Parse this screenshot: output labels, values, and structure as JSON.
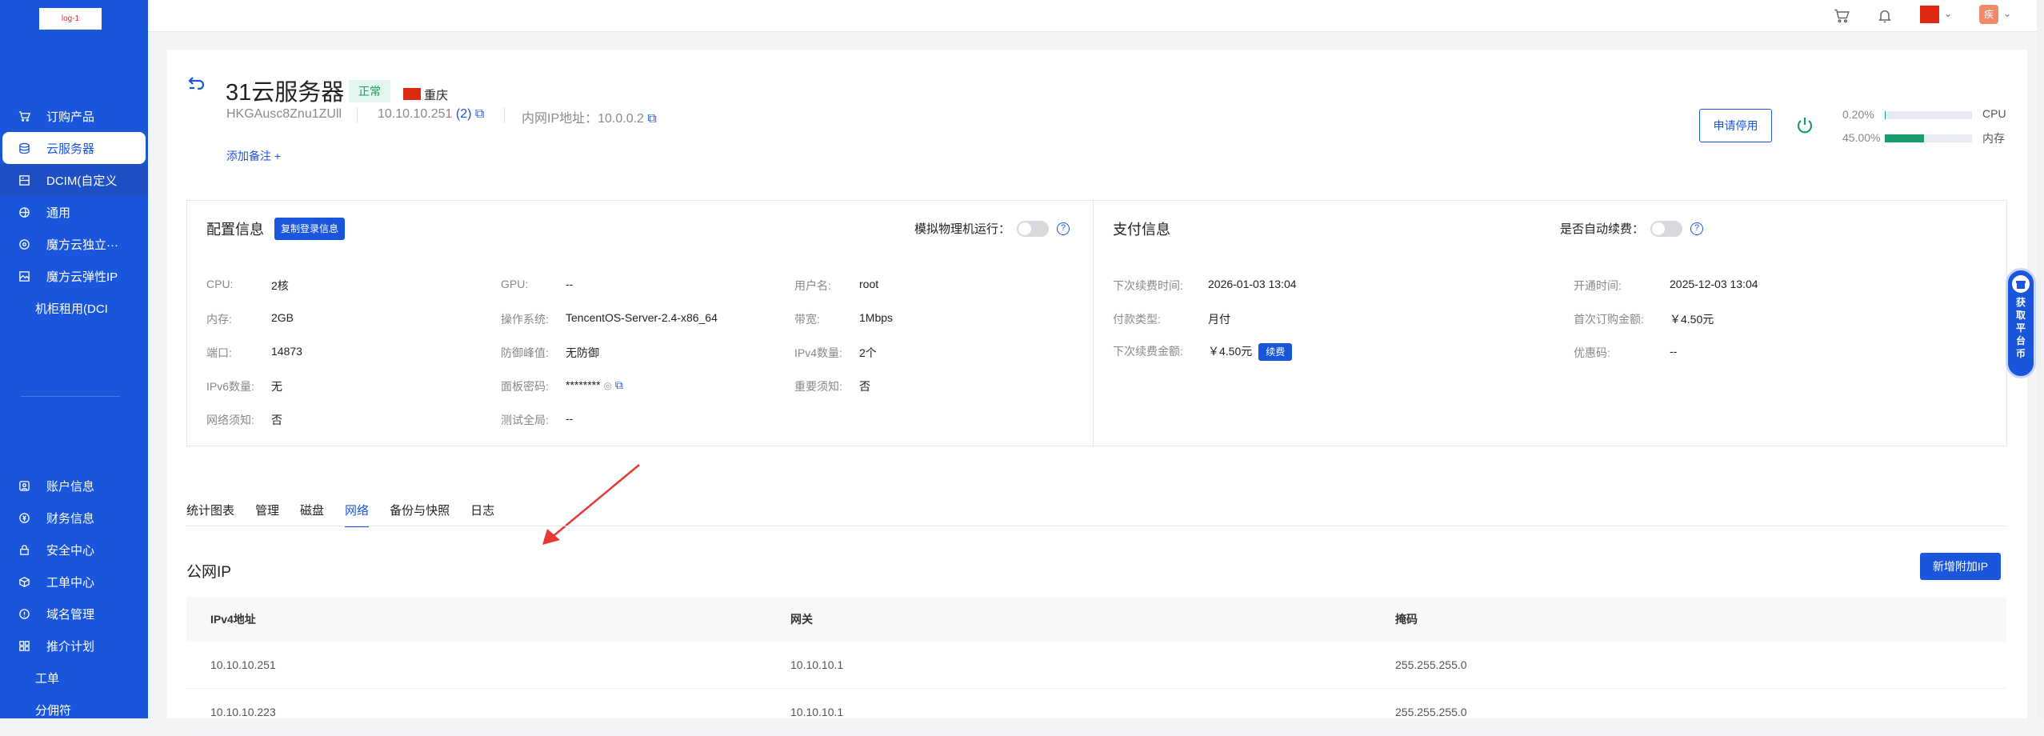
{
  "sidebar": {
    "logo_text": "log-1",
    "items": [
      {
        "label": "订购产品",
        "icon": "cart-icon"
      },
      {
        "label": "云服务器",
        "icon": "layers-icon"
      },
      {
        "label": "DCIM(自定义",
        "icon": "server-icon"
      },
      {
        "label": "通用",
        "icon": "globe-icon"
      },
      {
        "label": "魔方云独立···",
        "icon": "disc-icon"
      },
      {
        "label": "魔方云弹性IP",
        "icon": "image-icon"
      },
      {
        "label": "机柜租用(DCI",
        "icon": ""
      }
    ],
    "bottom_items": [
      {
        "label": "账户信息",
        "icon": "user-icon"
      },
      {
        "label": "财务信息",
        "icon": "money-icon"
      },
      {
        "label": "安全中心",
        "icon": "lock-icon"
      },
      {
        "label": "工单中心",
        "icon": "cube-icon"
      },
      {
        "label": "域名管理",
        "icon": "info-icon"
      },
      {
        "label": "推介计划",
        "icon": "grid-icon"
      },
      {
        "label": "工单",
        "icon": ""
      },
      {
        "label": "分佣符",
        "icon": ""
      }
    ]
  },
  "topbar": {
    "avatar_text": "疾"
  },
  "server": {
    "title": "31云服务器",
    "status": "正常",
    "region": "重庆",
    "hostname": "HKGAusc8Znu1ZUll",
    "ip": "10.10.10.251",
    "ip_count": "(2)",
    "private_ip_label": "内网IP地址：",
    "private_ip": "10.0.0.2",
    "add_note": "添加备注 +",
    "apply_stop": "申请停用",
    "cpu_pct": "0.20%",
    "cpu_fraction": 0.002,
    "cpu_label": "CPU",
    "mem_pct": "45.00%",
    "mem_fraction": 0.45,
    "mem_label": "内存"
  },
  "config": {
    "title": "配置信息",
    "copy_btn": "复制登录信息",
    "toggle_label": "模拟物理机运行：",
    "fields": [
      {
        "k": "CPU:",
        "v": "2核"
      },
      {
        "k": "内存:",
        "v": "2GB"
      },
      {
        "k": "端口:",
        "v": "14873"
      },
      {
        "k": "IPv6数量:",
        "v": "无"
      },
      {
        "k": "网络须知:",
        "v": "否"
      },
      {
        "k": "GPU:",
        "v": "--"
      },
      {
        "k": "操作系统:",
        "v": "TencentOS-Server-2.4-x86_64"
      },
      {
        "k": "防御峰值:",
        "v": "无防御"
      },
      {
        "k": "面板密码:",
        "v": "********"
      },
      {
        "k": "测试全局:",
        "v": "--"
      },
      {
        "k": "用户名:",
        "v": "root"
      },
      {
        "k": "带宽:",
        "v": "1Mbps"
      },
      {
        "k": "IPv4数量:",
        "v": "2个"
      },
      {
        "k": "重要须知:",
        "v": "否"
      }
    ]
  },
  "payment": {
    "title": "支付信息",
    "toggle_label": "是否自动续费：",
    "fields": [
      {
        "k": "下次续费时间:",
        "v": "2026-01-03 13:04"
      },
      {
        "k": "付款类型:",
        "v": "月付"
      },
      {
        "k": "下次续费金额:",
        "v": "￥4.50元"
      },
      {
        "k": "开通时间:",
        "v": "2025-12-03 13:04"
      },
      {
        "k": "首次订购金额:",
        "v": "￥4.50元"
      },
      {
        "k": "优惠码:",
        "v": "--"
      }
    ],
    "renew_btn": "续费"
  },
  "tabs": [
    "统计图表",
    "管理",
    "磁盘",
    "网络",
    "备份与快照",
    "日志"
  ],
  "active_tab": "网络",
  "network": {
    "section_title": "公网IP",
    "add_btn": "新增附加IP",
    "columns": [
      "IPv4地址",
      "网关",
      "掩码"
    ],
    "rows": [
      [
        "10.10.10.251",
        "10.10.10.1",
        "255.255.255.0"
      ],
      [
        "10.10.10.223",
        "10.10.10.1",
        "255.255.255.0"
      ]
    ]
  },
  "float_tab": {
    "text": "获取平台币"
  },
  "colors": {
    "primary": "#1a56db",
    "mem_bar": "#1a9d6b",
    "status_green": "#1a9d5b"
  }
}
